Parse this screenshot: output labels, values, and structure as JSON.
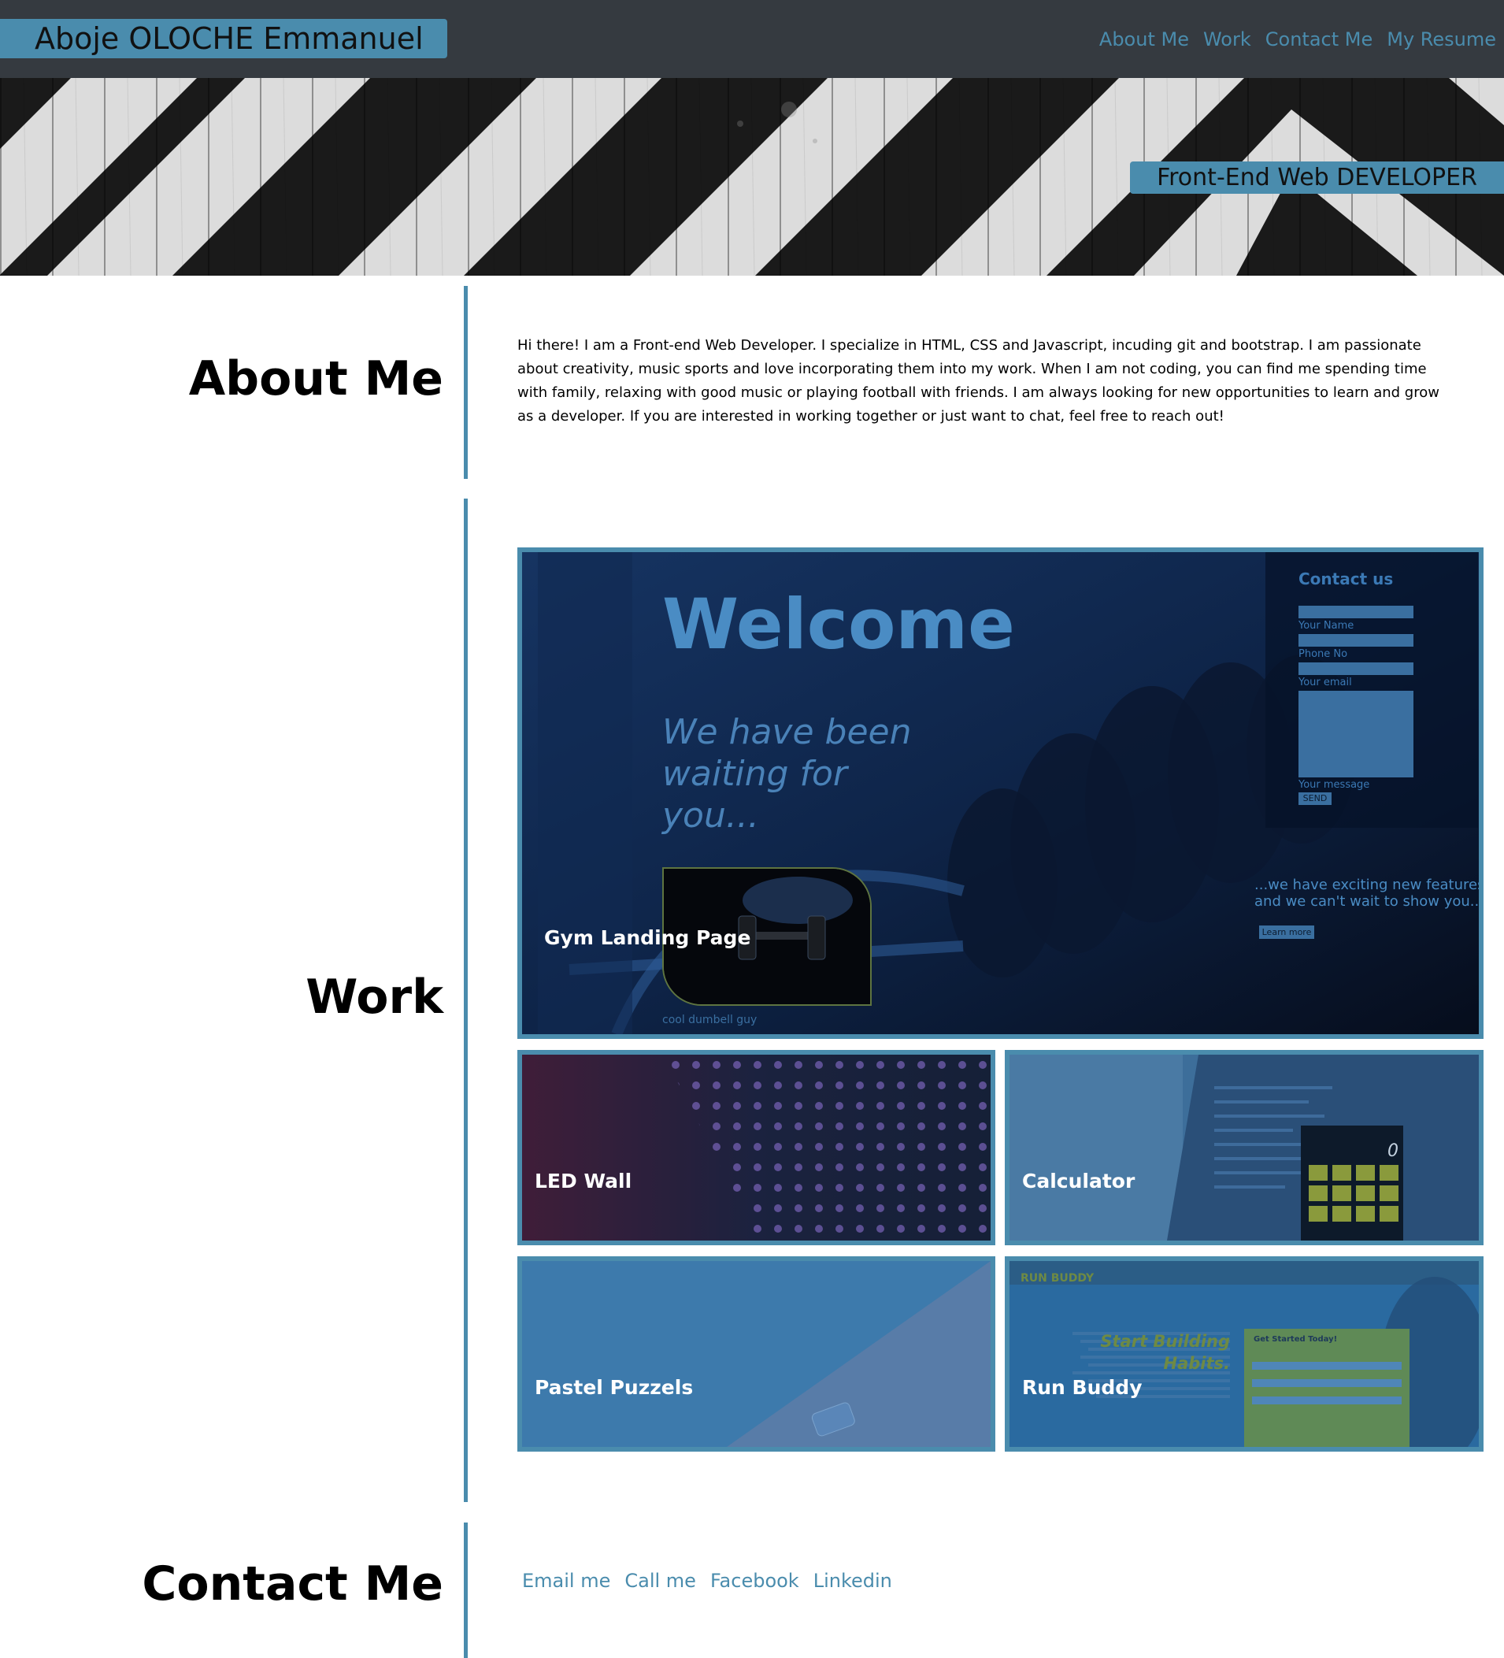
{
  "header": {
    "brand_name": "Aboje OLOCHE Emmanuel",
    "nav": [
      "About Me",
      "Work",
      "Contact Me",
      "My Resume"
    ]
  },
  "hero": {
    "tagline": "Front-End Web DEVELOPER"
  },
  "about": {
    "title": "About Me",
    "text": "Hi there! I am a Front-end Web Developer. I specialize in HTML, CSS and Javascript, incuding git and bootstrap. I am passionate about creativity, music sports and love incorporating them into my work. When I am not coding, you can find me spending time with family, relaxing with good music or playing football with friends. I am always looking for new opportunities to learn and grow as a developer. If you are interested in working together or just want to chat, feel free to reach out!"
  },
  "work": {
    "title": "Work",
    "projects": [
      {
        "label": "Gym Landing Page"
      },
      {
        "label": "LED Wall"
      },
      {
        "label": "Calculator"
      },
      {
        "label": "Pastel Puzzels"
      },
      {
        "label": "Run Buddy"
      }
    ],
    "gym_preview": {
      "welcome": "Welcome",
      "waiting": "We have been waiting for you...",
      "contact_title": "Contact us",
      "fields": [
        "Your Name",
        "Phone No",
        "Your email",
        "Your message"
      ],
      "send": "SEND",
      "features": "...we have exciting new features and we can't wait to show you...",
      "learn_more": "Learn more",
      "caption": "cool dumbell guy"
    },
    "calculator_preview": {
      "display": "0"
    },
    "runbuddy_preview": {
      "brand": "RUN BUDDY",
      "headline_1": "Start Building",
      "headline_2": "Habits.",
      "cta": "Get Started Today!"
    }
  },
  "contact": {
    "title": "Contact Me",
    "links": [
      "Email me",
      "Call me",
      "Facebook",
      "Linkedin"
    ]
  },
  "colors": {
    "accent": "#4a8cad",
    "header_bg": "#353a40"
  }
}
